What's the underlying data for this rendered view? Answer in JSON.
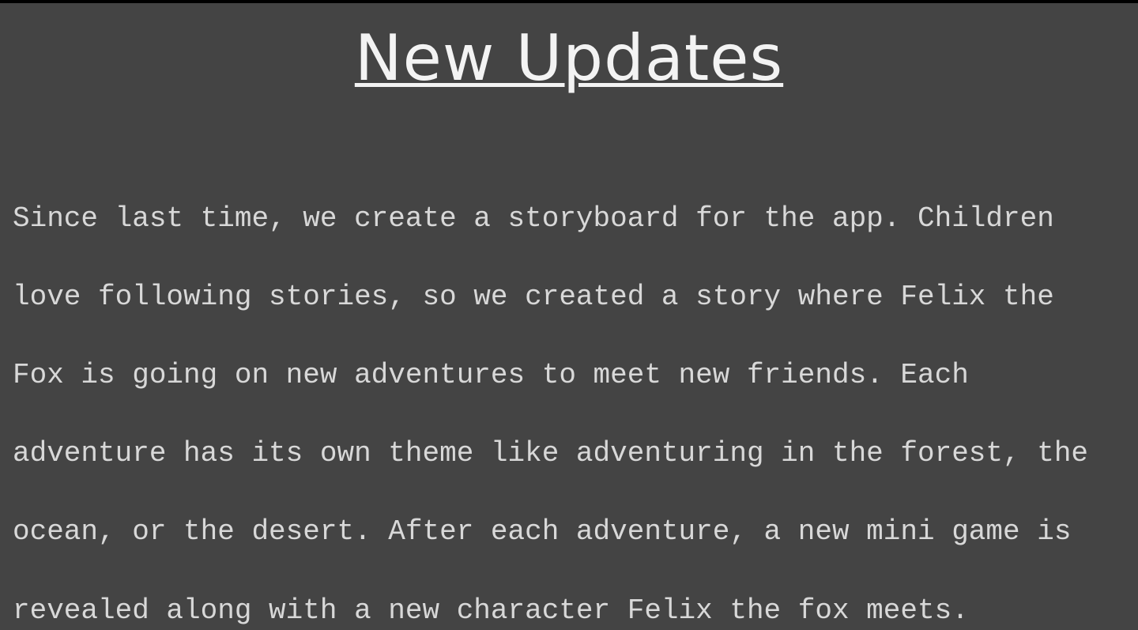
{
  "slide": {
    "title": "New Updates",
    "body_lines": [
      "Since last time, we create a storyboard for the app. Children",
      "love following stories, so we created a story where Felix the",
      "Fox is going on new adventures to meet new friends. Each",
      "adventure has its own theme like adventuring in the forest, the",
      "ocean, or the desert. After each adventure, a new mini game is",
      "revealed along with a new character Felix the fox meets."
    ]
  },
  "colors": {
    "background": "#444444",
    "title_text": "#f3f3f3",
    "body_text": "#d8d8d8",
    "top_border": "#000000"
  }
}
